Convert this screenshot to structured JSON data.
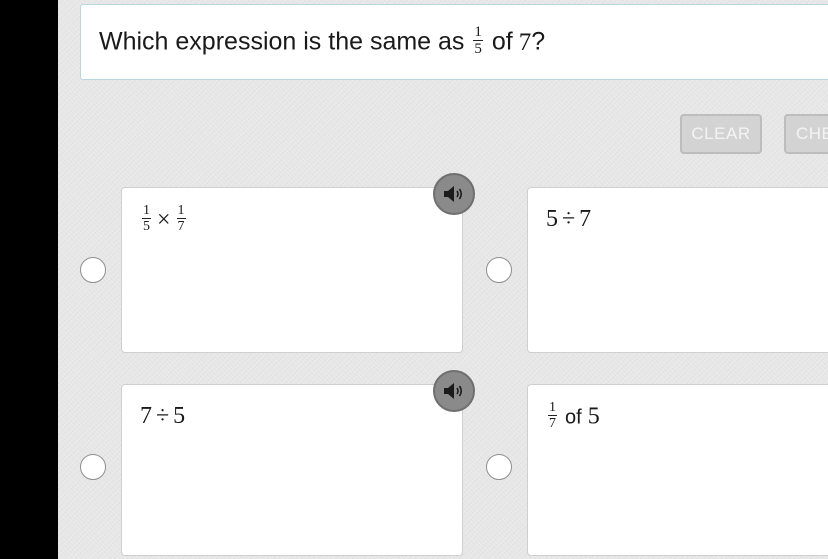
{
  "question": {
    "prefix": "Which expression is the same as",
    "fraction": {
      "num": "1",
      "den": "5"
    },
    "suffix_word": "of",
    "suffix_number": "7",
    "suffix_mark": "?"
  },
  "buttons": {
    "clear_label": "CLEAR",
    "check_label": "CHE"
  },
  "options": [
    {
      "frac_a": {
        "num": "1",
        "den": "5"
      },
      "op": "×",
      "frac_b": {
        "num": "1",
        "den": "7"
      }
    },
    {
      "a": "5",
      "op": "÷",
      "b": "7"
    },
    {
      "a": "7",
      "op": "÷",
      "b": "5"
    },
    {
      "frac": {
        "num": "1",
        "den": "7"
      },
      "word": "of",
      "b": "5"
    }
  ],
  "icons": {
    "speaker": "speaker-icon",
    "radio": "radio-button"
  },
  "colors": {
    "background": "#e6e6e6",
    "button_bg": "#d3d3d3",
    "speaker_bg": "#8a8a8a",
    "question_border": "#b9d7df"
  }
}
